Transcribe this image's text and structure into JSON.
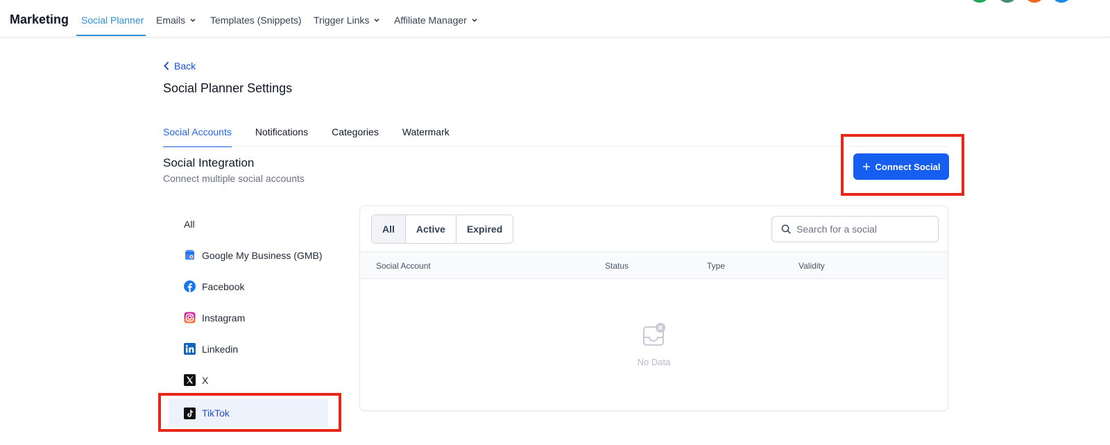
{
  "nav": {
    "brand": "Marketing",
    "items": [
      {
        "label": "Social Planner"
      },
      {
        "label": "Emails"
      },
      {
        "label": "Templates (Snippets)"
      },
      {
        "label": "Trigger Links"
      },
      {
        "label": "Affiliate Manager"
      }
    ],
    "avatar_colors": [
      "#22a85a",
      "#3f8f6a",
      "#f06a1d",
      "#1e88e5"
    ]
  },
  "header": {
    "back_label": "Back",
    "title": "Social Planner Settings"
  },
  "tabs": [
    {
      "label": "Social Accounts"
    },
    {
      "label": "Notifications"
    },
    {
      "label": "Categories"
    },
    {
      "label": "Watermark"
    }
  ],
  "section": {
    "title": "Social Integration",
    "subtitle": "Connect multiple social accounts",
    "connect_button": "Connect Social"
  },
  "platforms": [
    {
      "label": "All",
      "icon": "none"
    },
    {
      "label": "Google My Business (GMB)",
      "icon": "gmb-icon"
    },
    {
      "label": "Facebook",
      "icon": "facebook-icon"
    },
    {
      "label": "Instagram",
      "icon": "instagram-icon"
    },
    {
      "label": "Linkedin",
      "icon": "linkedin-icon"
    },
    {
      "label": "X",
      "icon": "x-icon"
    },
    {
      "label": "TikTok",
      "icon": "tiktok-icon",
      "selected": true
    }
  ],
  "filters": [
    {
      "label": "All",
      "active": true
    },
    {
      "label": "Active"
    },
    {
      "label": "Expired"
    }
  ],
  "search": {
    "placeholder": "Search for a social"
  },
  "table": {
    "columns": [
      "Social Account",
      "Status",
      "Type",
      "Validity"
    ],
    "empty_text": "No Data"
  },
  "colors": {
    "accent": "#155eef",
    "nav_active": "#2f8fd8",
    "highlight": "#e8271a"
  }
}
